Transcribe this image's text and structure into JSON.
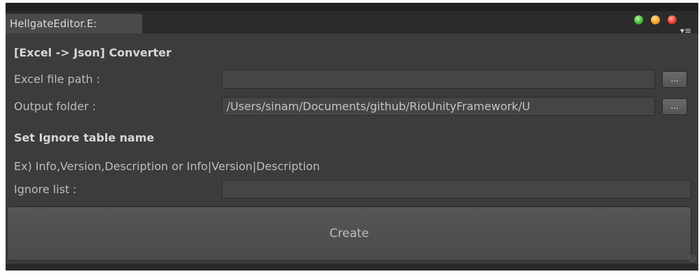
{
  "window": {
    "tab_title": "HellgateEditor.E:"
  },
  "converter": {
    "title": "[Excel -> Json] Converter",
    "excel_label": "Excel file path :",
    "excel_value": "",
    "excel_browse_label": "...",
    "output_label": "Output folder :",
    "output_value": "/Users/sinam/Documents/github/RioUnityFramework/U",
    "output_browse_label": "..."
  },
  "ignore": {
    "title": "Set Ignore table name",
    "example": "Ex) Info,Version,Description  or  Info|Version|Description",
    "list_label": "Ignore list :",
    "list_value": ""
  },
  "actions": {
    "create_label": "Create"
  },
  "colors": {
    "panel": "#3c3c3c",
    "field": "#454545",
    "text": "#bdbdbd"
  },
  "icons": {
    "traffic_green": "maximize-icon",
    "traffic_yellow": "minimize-icon",
    "traffic_red": "close-icon",
    "menu": "window-menu-icon"
  }
}
